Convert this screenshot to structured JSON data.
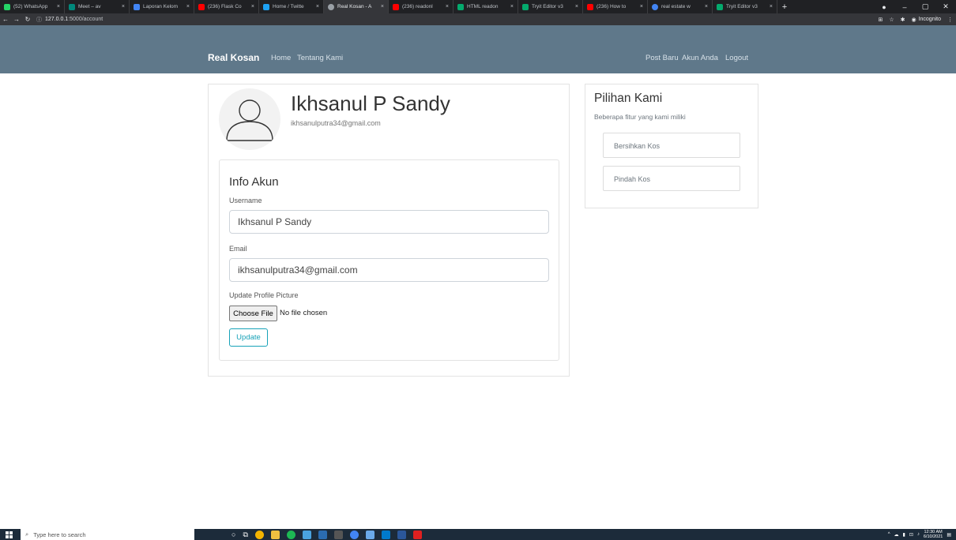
{
  "browser": {
    "tabs": [
      {
        "title": "(52) WhatsApp",
        "color": "#25d366"
      },
      {
        "title": "Meet – av",
        "color": "#00897b"
      },
      {
        "title": "Laporan Kelom",
        "color": "#4285f4"
      },
      {
        "title": "(236) Flask Co",
        "color": "#ff0000"
      },
      {
        "title": "Home / Twitte",
        "color": "#1da1f2"
      },
      {
        "title": "Real Kosan - A",
        "color": "#9aa0a6",
        "active": true
      },
      {
        "title": "(236) readonl",
        "color": "#ff0000"
      },
      {
        "title": "HTML readon",
        "color": "#04aa6d"
      },
      {
        "title": "Tryit Editor v3",
        "color": "#04aa6d"
      },
      {
        "title": "(236) How to",
        "color": "#ff0000"
      },
      {
        "title": "real estate w",
        "color": "#4285f4"
      },
      {
        "title": "Tryit Editor v3",
        "color": "#04aa6d"
      }
    ],
    "new_tab": "+",
    "url_host": "127.0.0.1",
    "url_path": ":5000/account",
    "incognito_label": "Incognito"
  },
  "navbar": {
    "brand": "Real Kosan",
    "left_links": [
      "Home",
      "Tentang Kami"
    ],
    "right_links": [
      "Post Baru",
      "Akun Anda",
      "Logout"
    ]
  },
  "profile": {
    "name": "Ikhsanul P Sandy",
    "email": "ikhsanulputra34@gmail.com"
  },
  "form": {
    "title": "Info Akun",
    "username_label": "Username",
    "username_value": "Ikhsanul P Sandy",
    "email_label": "Email",
    "email_value": "ikhsanulputra34@gmail.com",
    "picture_label": "Update Profile Picture",
    "choose_file": "Choose File",
    "no_file": "No file chosen",
    "submit": "Update"
  },
  "sidebar": {
    "title": "Pilihan Kami",
    "subtitle": "Beberapa fitur yang kami miliki",
    "items": [
      "Bersihkan Kos",
      "Pindah Kos"
    ]
  },
  "taskbar": {
    "search_placeholder": "Type here to search",
    "time": "12:30 AM",
    "date": "6/10/2021"
  },
  "colors": {
    "navbar": "#5f788a",
    "accent": "#17a2b8"
  }
}
